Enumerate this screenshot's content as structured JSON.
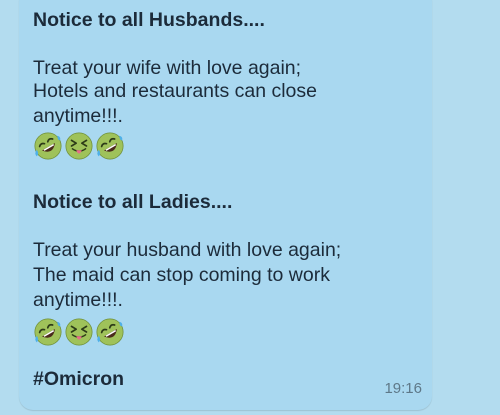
{
  "message": {
    "notice1": {
      "title": "Notice to all Husbands....",
      "lines": [
        "Treat your wife with love again;",
        "Hotels and restaurants can close",
        "anytime!!!."
      ]
    },
    "notice2": {
      "title": "Notice to all Ladies....",
      "lines": [
        "Treat your husband with love again;",
        "The maid can stop coming to work",
        "anytime!!!."
      ]
    },
    "emojis": [
      "rolling-on-floor-laughing-icon",
      "squinting-face-with-tongue-icon",
      "rolling-on-floor-laughing-icon"
    ],
    "hashtag": "#Omicron",
    "time": "19:16"
  },
  "colors": {
    "background": "#b3dcef",
    "bubble": "#a9d8f0",
    "text": "#1c2b3a",
    "timestamp": "#5e7888",
    "emoji_face": "#9fc25a"
  }
}
